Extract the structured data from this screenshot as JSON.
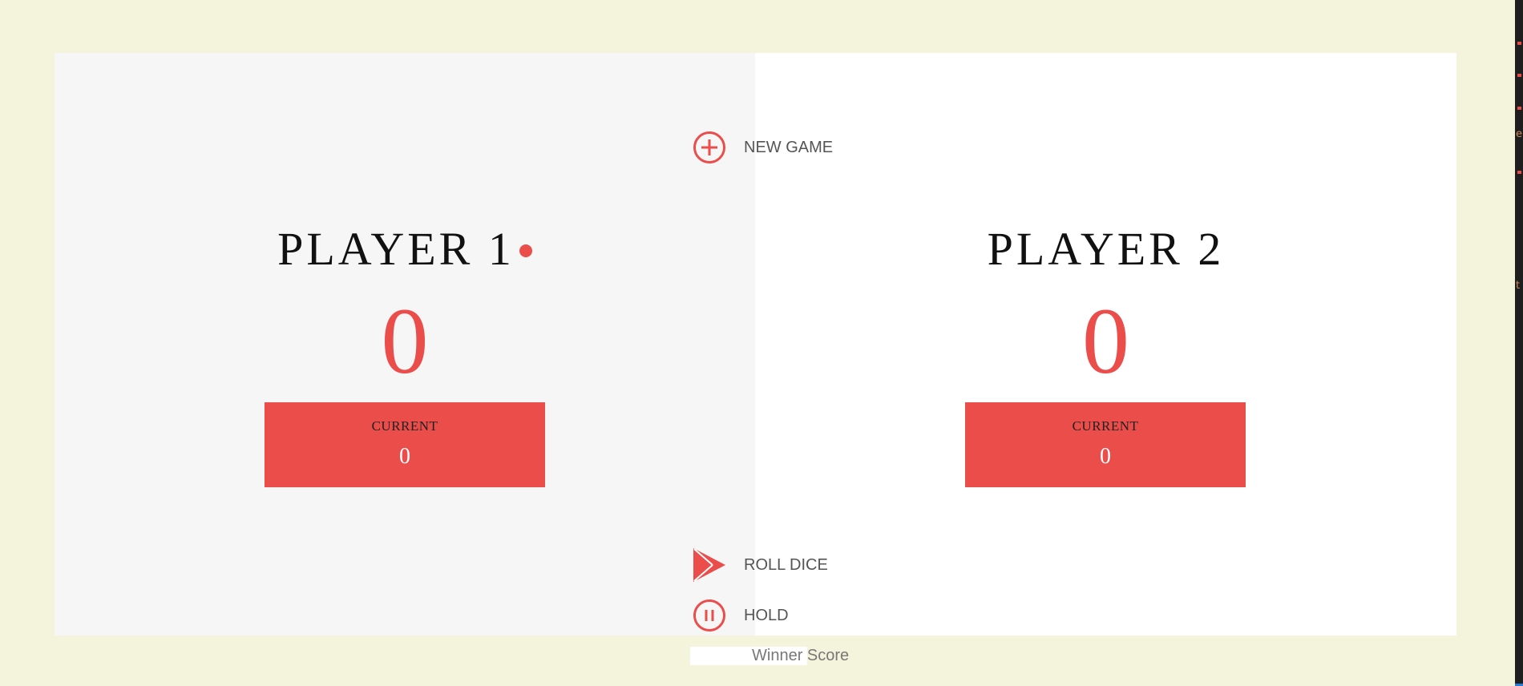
{
  "theme": {
    "accent": "#eb4d4b",
    "page_background": "#f4f4dc",
    "active_panel_background": "#f6f6f6",
    "inactive_panel_background": "#ffffff"
  },
  "buttons": {
    "new_game": {
      "label": "NEW GAME",
      "icon": "plus-circle-icon"
    },
    "roll_dice": {
      "label": "ROLL DICE",
      "icon": "play-triangle-icon"
    },
    "hold": {
      "label": "HOLD",
      "icon": "pause-circle-icon"
    }
  },
  "winner_score": {
    "placeholder": "Winner Score",
    "value": ""
  },
  "players": [
    {
      "name": "PLAYER 1",
      "score": "0",
      "current_label": "CURRENT",
      "current_score": "0",
      "active": true
    },
    {
      "name": "PLAYER 2",
      "score": "0",
      "current_label": "CURRENT",
      "current_score": "0",
      "active": false
    }
  ],
  "edge_strip": {
    "glyphs": [
      "e",
      "t"
    ]
  }
}
